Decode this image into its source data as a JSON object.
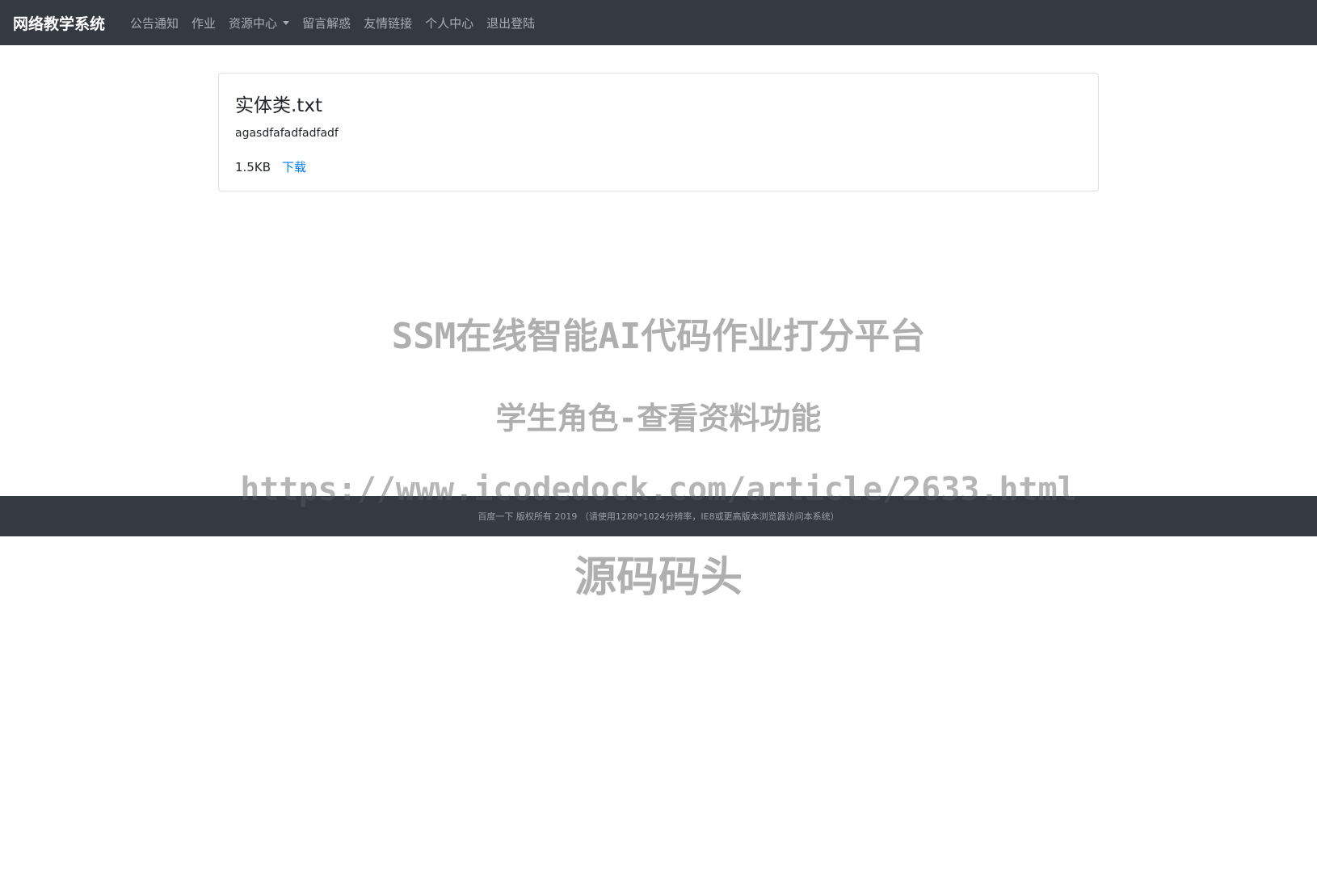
{
  "navbar": {
    "brand": "网络教学系统",
    "items": [
      {
        "label": "公告通知"
      },
      {
        "label": "作业"
      },
      {
        "label": "资源中心"
      },
      {
        "label": "留言解惑"
      },
      {
        "label": "友情链接"
      },
      {
        "label": "个人中心"
      },
      {
        "label": "退出登陆"
      }
    ]
  },
  "resource": {
    "title": "实体类.txt",
    "description": "agasdfafadfadfadf",
    "size": "1.5KB",
    "download_label": "下载"
  },
  "footer": {
    "text": "百度一下  版权所有 2019  （请使用1280*1024分辨率，IE8或更高版本浏览器访问本系统）"
  },
  "watermark": {
    "line1": "SSM在线智能AI代码作业打分平台",
    "line2": "学生角色-查看资料功能",
    "line3": "https://www.icodedock.com/article/2633.html",
    "line4": "源码码头"
  },
  "colors": {
    "navbar_bg": "#343a40",
    "link": "#007bff"
  }
}
